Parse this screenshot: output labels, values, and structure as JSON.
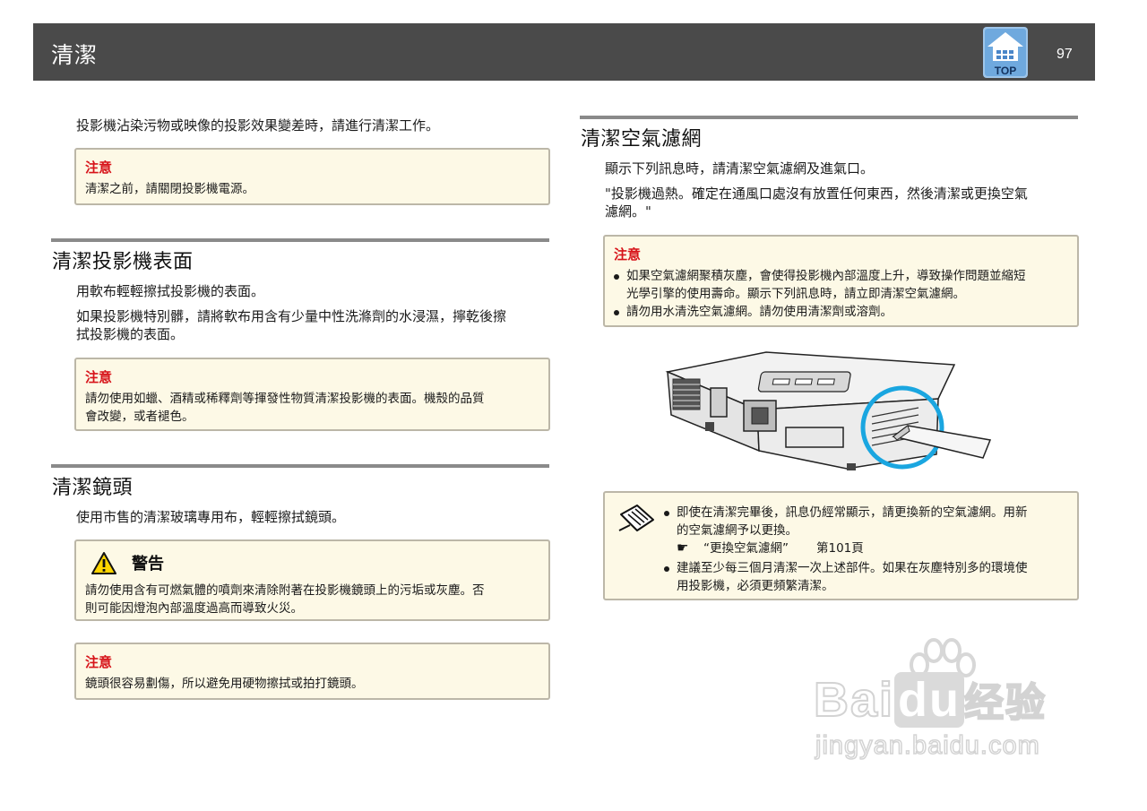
{
  "header": {
    "title": "清潔",
    "top_label": "TOP",
    "page_number": "97"
  },
  "left": {
    "intro": "投影機沾染污物或映像的投影效果變差時，請進行清潔工作。",
    "caution1": {
      "label": "注意",
      "text": "清潔之前，請關閉投影機電源。"
    },
    "section_surface": {
      "title": "清潔投影機表面",
      "p1": "用軟布輕輕擦拭投影機的表面。",
      "p2_line1": "如果投影機特別髒，請將軟布用含有少量中性洗滌劑的水浸濕，擰乾後擦",
      "p2_line2": "拭投影機的表面。",
      "caution": {
        "label": "注意",
        "line1": "請勿使用如蠟、酒精或稀釋劑等揮發性物質清潔投影機的表面。機殼的品質",
        "line2": "會改變，或者褪色。"
      }
    },
    "section_lens": {
      "title": "清潔鏡頭",
      "p1": "使用市售的清潔玻璃專用布，輕輕擦拭鏡頭。",
      "warning": {
        "label": "警告",
        "line1": "請勿使用含有可燃氣體的噴劑來清除附著在投影機鏡頭上的污垢或灰塵。否",
        "line2": "則可能因燈泡內部溫度過高而導致火災。"
      },
      "caution": {
        "label": "注意",
        "text": "鏡頭很容易劃傷，所以避免用硬物擦拭或拍打鏡頭。"
      }
    }
  },
  "right": {
    "section_filter": {
      "title": "清潔空氣濾網",
      "p1": "顯示下列訊息時，請清潔空氣濾網及進氣口。",
      "p2_line1": "\"投影機過熱。確定在通風口處沒有放置任何東西，然後清潔或更換空氣",
      "p2_line2": "濾網。\"",
      "caution": {
        "label": "注意",
        "b1_line1": "如果空氣濾網聚積灰塵，會使得投影機內部溫度上升，導致操作問題並縮短",
        "b1_line2": "光學引擎的使用壽命。顯示下列訊息時，請立即清潔空氣濾網。",
        "b2": "請勿用水清洗空氣濾網。請勿使用清潔劑或溶劑。"
      },
      "note": {
        "b1_line1": "即使在清潔完畢後，訊息仍經常顯示，請更換新的空氣濾網。用新",
        "b1_line2": "的空氣濾網予以更換。",
        "ref_text": "“更換空氣濾網”",
        "ref_page": "第101頁",
        "b2_line1": "建議至少每三個月清潔一次上述部件。如果在灰塵特別多的環境使",
        "b2_line2": "用投影機，必須更頻繁清潔。"
      }
    }
  },
  "watermark": {
    "brand_a": "Bai",
    "brand_b": "du",
    "brand_c": "经验",
    "url": "jingyan.baidu.com"
  },
  "colors": {
    "header_bg": "#4a4a4a",
    "caution_red": "#d7141a",
    "box_bg": "#fdf9e6",
    "link_blue": "#1b3d9c"
  },
  "icons": [
    "top-home-icon",
    "warning-triangle-icon",
    "note-pencil-icon",
    "pointing-hand-icon",
    "projector-illustration"
  ]
}
